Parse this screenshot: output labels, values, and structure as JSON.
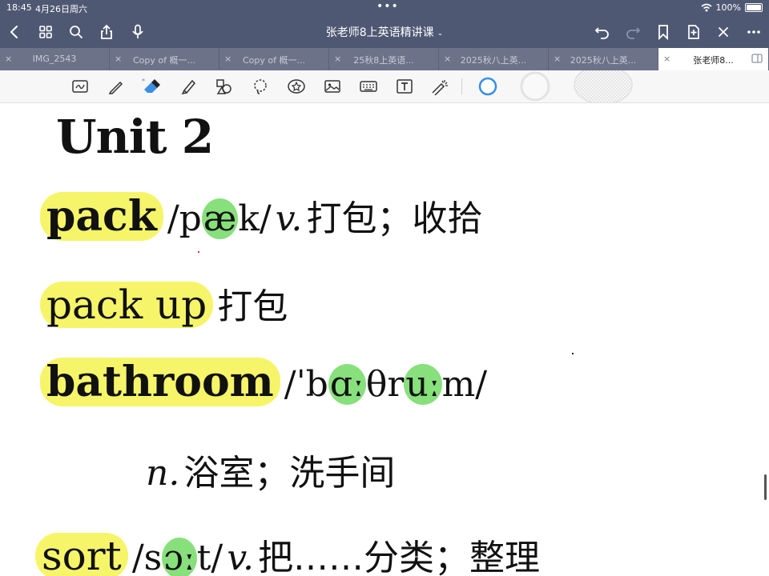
{
  "status": {
    "time": "18:45",
    "date": "4月26日周六",
    "battery": "100%"
  },
  "nav": {
    "title": "张老师8上英语精讲课"
  },
  "tabs": [
    {
      "label": "IMG_2543",
      "active": false
    },
    {
      "label": "Copy of 概一...",
      "active": false
    },
    {
      "label": "Copy of 概一...",
      "active": false
    },
    {
      "label": "25秋8上英语...",
      "active": false
    },
    {
      "label": "2025秋八上英...",
      "active": false
    },
    {
      "label": "2025秋八上英...",
      "active": false
    },
    {
      "label": "张老师8...",
      "active": true
    }
  ],
  "content": {
    "unit_title": "Unit 2",
    "entries": [
      {
        "word": "pack",
        "phonetic_parts": [
          "/p",
          "æ",
          "k/"
        ],
        "pos": "v.",
        "meaning": "打包；收拾"
      },
      {
        "word": "pack up",
        "meaning": "打包"
      },
      {
        "word": "bathroom",
        "phonetic_parts": [
          "/ˈb",
          "ɑː",
          "θr",
          "uː",
          "m/"
        ],
        "pos": "n.",
        "meaning": "浴室；洗手间"
      },
      {
        "word": "sort",
        "phonetic_parts": [
          "/s",
          "ɔː",
          "t/"
        ],
        "pos": "v.",
        "meaning": "把……分类；整理"
      }
    ]
  },
  "colors": {
    "chrome": "#4f5873",
    "tabs": "#6c7389",
    "highlight_yellow": "#f6f56a",
    "highlight_green": "#87e07b",
    "accent_blue": "#3a8ee6"
  }
}
